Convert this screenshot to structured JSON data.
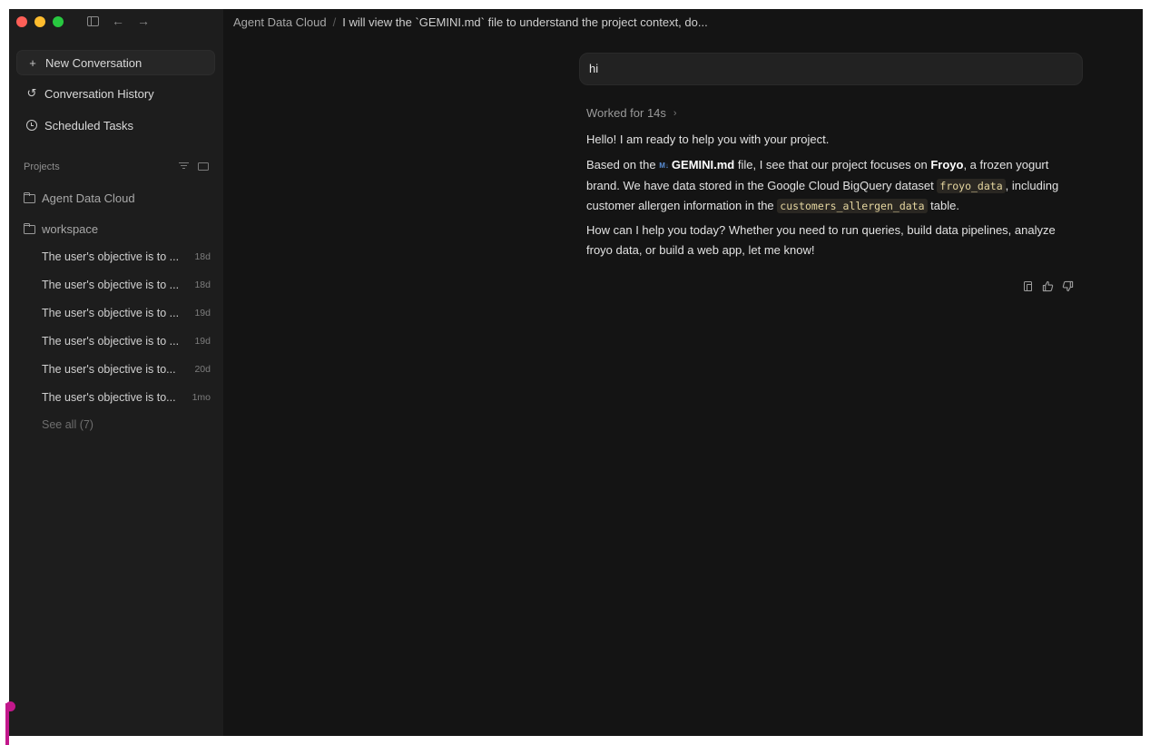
{
  "window_controls": {
    "close": "red",
    "minimize": "yellow",
    "zoom": "green"
  },
  "toolbar_icons": [
    "sidebar-toggle-icon",
    "back-arrow-icon",
    "forward-arrow-icon"
  ],
  "sidebar": {
    "nav": [
      {
        "label": "New Conversation",
        "icon": "plus-icon",
        "active": true
      },
      {
        "label": "Conversation History",
        "icon": "history-icon",
        "active": false
      },
      {
        "label": "Scheduled Tasks",
        "icon": "clock-icon",
        "active": false
      }
    ],
    "projects_label": "Projects",
    "projects": [
      {
        "label": "Agent Data Cloud",
        "icon": "folder-icon"
      },
      {
        "label": "workspace",
        "icon": "folder-open-icon"
      }
    ],
    "conversations": [
      {
        "title": "The user's objective is to ...",
        "age": "18d"
      },
      {
        "title": "The user's objective is to ...",
        "age": "18d"
      },
      {
        "title": "The user's objective is to ...",
        "age": "19d"
      },
      {
        "title": "The user's objective is to ...",
        "age": "19d"
      },
      {
        "title": "The user's objective is to...",
        "age": "20d"
      },
      {
        "title": "The user's objective is to...",
        "age": "1mo"
      }
    ],
    "see_all": "See all (7)"
  },
  "breadcrumb": {
    "root": "Agent Data Cloud",
    "separator": "/",
    "current": "I will view the `GEMINI.md` file to understand the project context, do..."
  },
  "chat": {
    "user_message": "hi",
    "worked_for": "Worked for 14s",
    "greeting": "Hello! I am ready to help you with your project.",
    "p2": {
      "t1": "Based on the ",
      "file_icon": "M↓",
      "file": "GEMINI.md",
      "t2": " file, I see that our project focuses on ",
      "brand": "Froyo",
      "t3": ", a frozen yogurt brand. We have data stored in the Google Cloud BigQuery dataset ",
      "dataset": "froyo_data",
      "t4": ", including customer allergen information in the ",
      "table": "customers_allergen_data",
      "t5": " table."
    },
    "p3": "How can I help you today? Whether you need to run queries, build data pipelines, analyze froyo data, or build a web app, let me know!",
    "actions": [
      "copy-icon",
      "thumbs-up-icon",
      "thumbs-down-icon"
    ]
  },
  "colors": {
    "window_bg": "#141414",
    "sidebar_bg": "#1d1d1d",
    "code_text": "#e6d7a0",
    "accent_pink": "#c2188b"
  }
}
